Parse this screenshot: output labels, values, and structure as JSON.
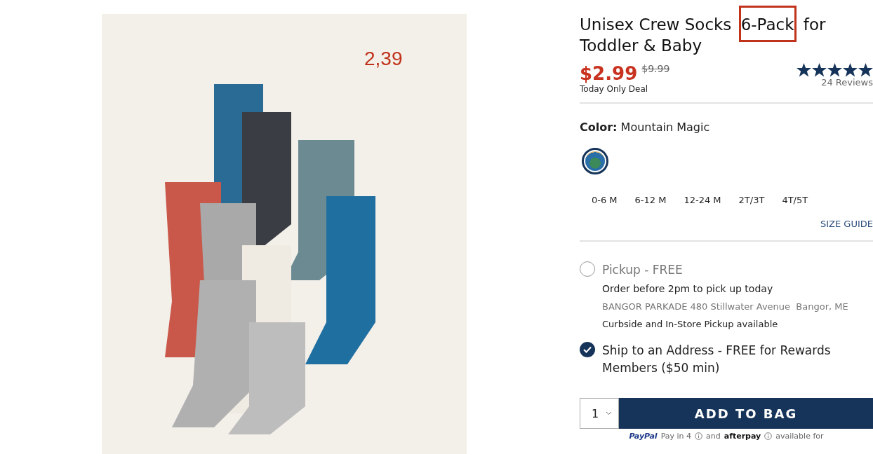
{
  "photo": {
    "annotation": "2,39"
  },
  "product": {
    "title_start": "Unisex Crew Socks ",
    "title_highlight": "6-Pack",
    "title_end": " for Toddler & Baby",
    "price": "$2.99",
    "old_price": "$9.99",
    "deal": "Today Only Deal",
    "stars": 5,
    "reviews": "24 Reviews"
  },
  "color": {
    "label": "Color:",
    "value": "Mountain Magic",
    "swatches": [
      {
        "selected": true
      }
    ]
  },
  "sizes": [
    {
      "label": "0-6 M",
      "selected": false
    },
    {
      "label": "6-12 M",
      "selected": false
    },
    {
      "label": "12-24 M",
      "selected": false
    },
    {
      "label": "2T/3T",
      "selected": false
    },
    {
      "label": "4T/5T",
      "selected": false
    }
  ],
  "size_guide": "SIZE GUIDE",
  "delivery": [
    {
      "title": "Pickup - FREE",
      "checked": false,
      "lines": [
        "Order before 2pm to pick up today",
        "BANGOR PARKADE 480 Stillwater Avenue  Bangor, ME",
        "Curbside and In-Store Pickup available"
      ]
    },
    {
      "title": "Ship to an Address - FREE for Rewards Members ($50 min)",
      "checked": true
    }
  ],
  "quantity": "1",
  "add_button": "ADD TO BAG",
  "payment": {
    "paypal": "PayPal",
    "text1": "Pay in 4",
    "text2": "and",
    "afterpay": "afterpay",
    "text3": "available for"
  }
}
